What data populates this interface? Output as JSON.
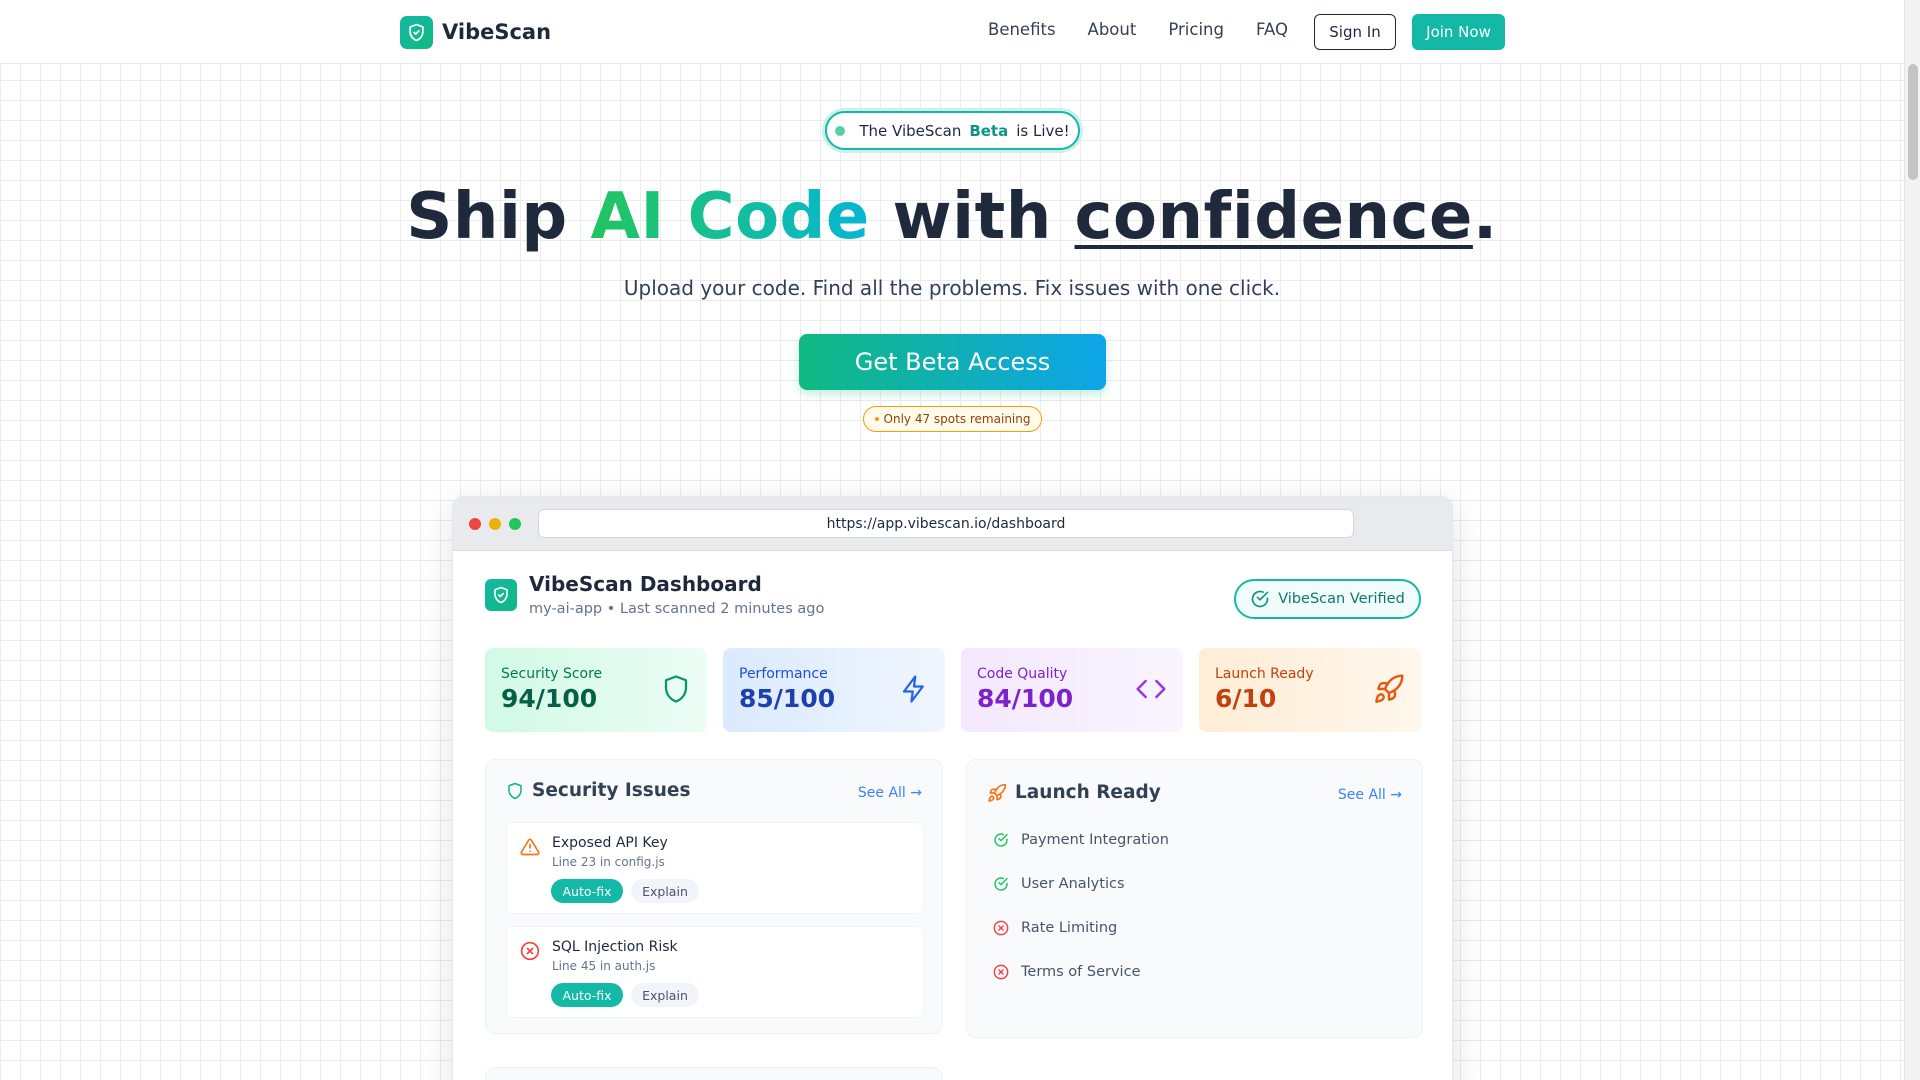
{
  "nav": {
    "brand": "VibeScan",
    "links": [
      "Benefits",
      "About",
      "Pricing",
      "FAQ"
    ],
    "signin_label": "Sign In",
    "join_label": "Join Now"
  },
  "hero": {
    "pill_prefix": "The VibeScan",
    "pill_beta": "Beta",
    "pill_suffix": "is Live!",
    "headline_part1": "Ship",
    "headline_grad": "AI Code",
    "headline_part2": "with",
    "headline_under": "confidence",
    "headline_end": ".",
    "subhead": "Upload your code. Find all the problems. Fix issues with one click.",
    "cta_label": "Get Beta Access",
    "spots_label": "Only 47 spots remaining"
  },
  "browser": {
    "url": "https://app.vibescan.io/dashboard"
  },
  "dashboard": {
    "title": "VibeScan Dashboard",
    "subtitle": "my-ai-app • Last scanned 2 minutes ago",
    "verified_label": "VibeScan Verified",
    "metrics": [
      {
        "label": "Security Score",
        "value": "94/100",
        "icon": "shield-icon"
      },
      {
        "label": "Performance",
        "value": "85/100",
        "icon": "lightning-icon"
      },
      {
        "label": "Code Quality",
        "value": "84/100",
        "icon": "code-icon"
      },
      {
        "label": "Launch Ready",
        "value": "6/10",
        "icon": "rocket-icon"
      }
    ],
    "security": {
      "title": "Security Issues",
      "see_all": "See All →",
      "issues": [
        {
          "title": "Exposed API Key",
          "location": "Line 23 in config.js",
          "icon": "warning-icon",
          "autofix": "Auto-fix",
          "explain": "Explain"
        },
        {
          "title": "SQL Injection Risk",
          "location": "Line 45 in auth.js",
          "icon": "error-icon",
          "autofix": "Auto-fix",
          "explain": "Explain"
        }
      ]
    },
    "launch": {
      "title": "Launch Ready",
      "see_all": "See All →",
      "items": [
        {
          "label": "Payment Integration",
          "status": "done"
        },
        {
          "label": "User Analytics",
          "status": "done"
        },
        {
          "label": "Rate Limiting",
          "status": "missing"
        },
        {
          "label": "Terms of Service",
          "status": "missing"
        }
      ]
    }
  },
  "colors": {
    "accent": "#14b8a6",
    "success": "#22c55e",
    "error": "#ef4444",
    "warning": "#f97316"
  }
}
